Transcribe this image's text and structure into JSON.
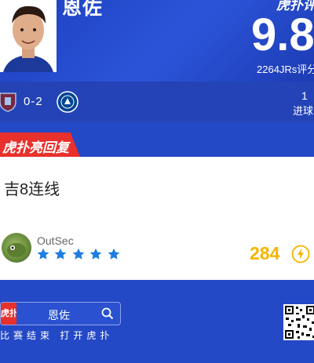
{
  "player": {
    "name": "恩佐"
  },
  "rating": {
    "brand": "虎扑评分",
    "score": "9.8",
    "count": "2264JRs评分"
  },
  "match": {
    "score": "0-2",
    "goals_value": "1",
    "goals_label": "进球"
  },
  "reply_tag": {
    "label": "虎扑亮回复"
  },
  "comment": {
    "text": "吉8连线",
    "user_name": "OutSec",
    "stars": 5,
    "likes": "284"
  },
  "search": {
    "logo": "虎扑",
    "query": "恩佐",
    "caption": "比赛结束 打开虎扑"
  },
  "colors": {
    "primary_blue": "#2449c7",
    "accent_red": "#e8302c",
    "star_blue": "#1e7de0",
    "like_gold": "#f4b400"
  }
}
